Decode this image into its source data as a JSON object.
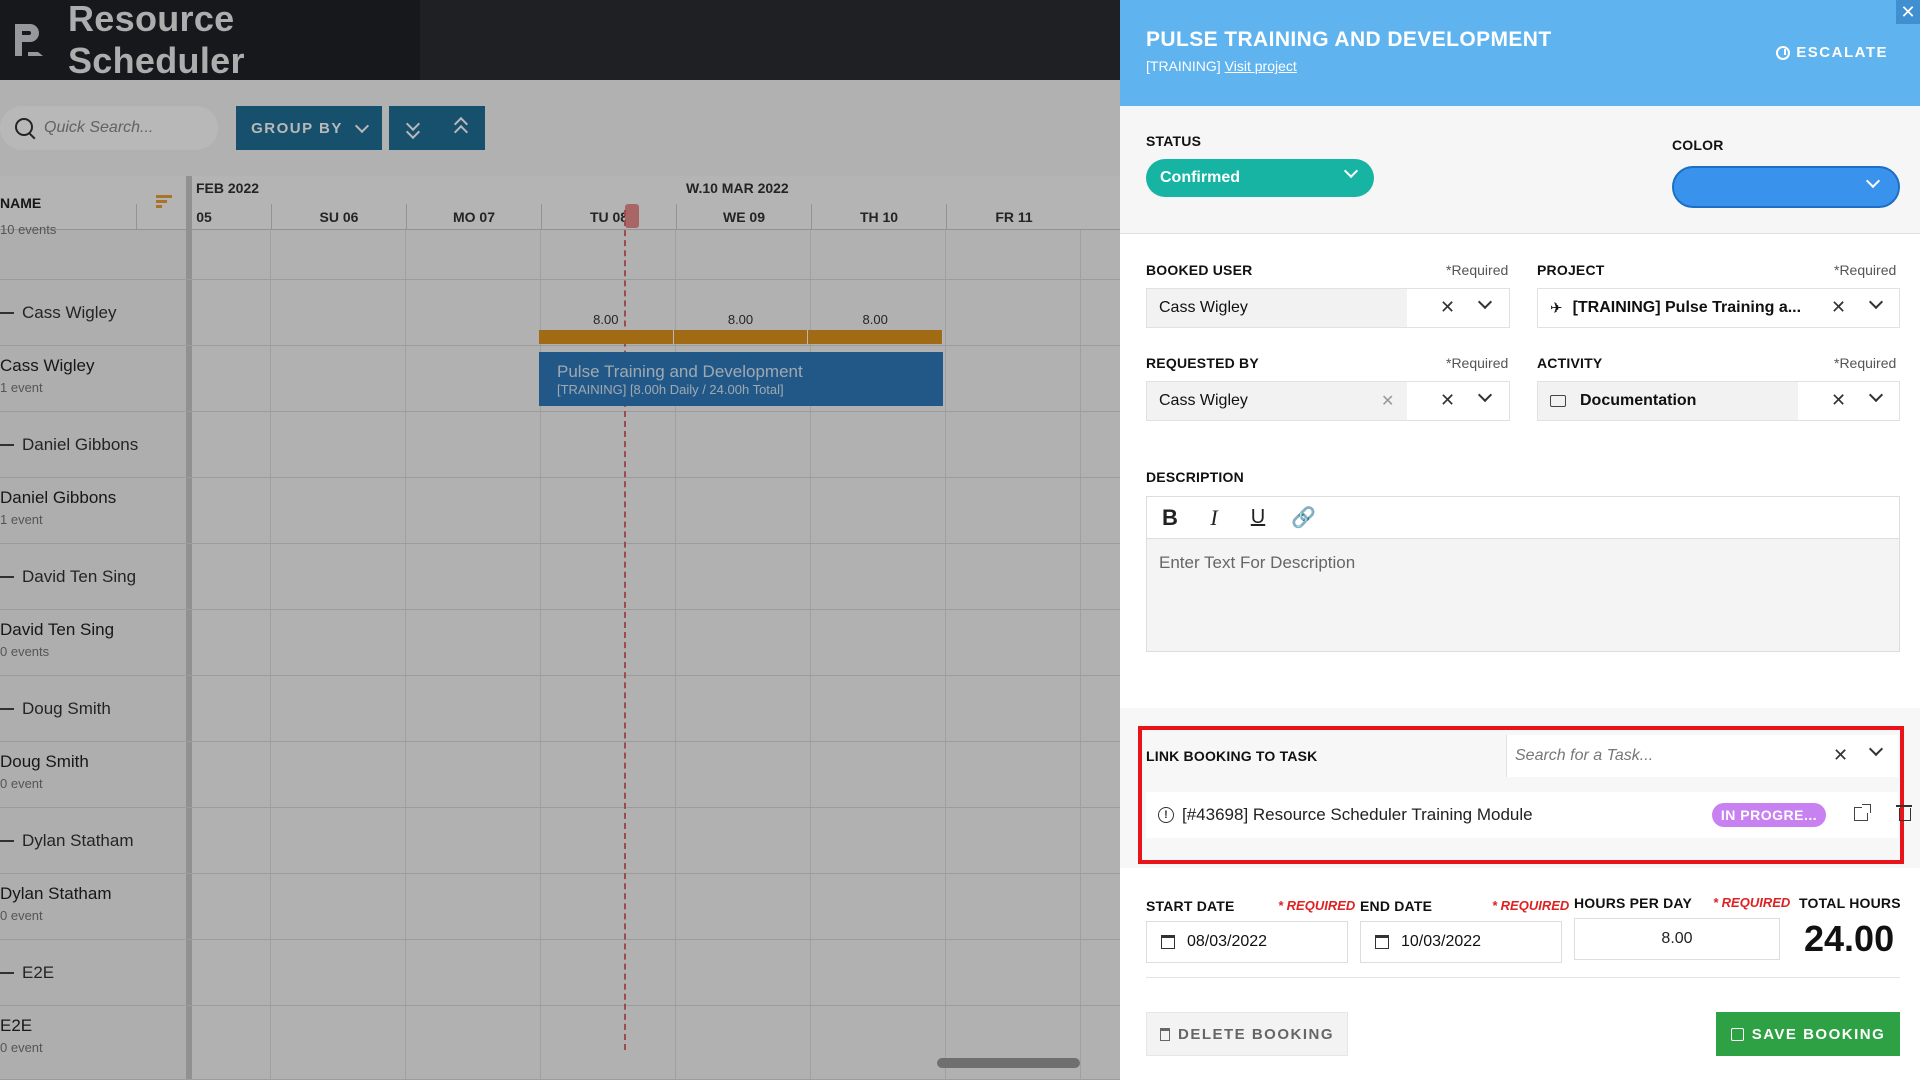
{
  "app": {
    "title": "Resource Scheduler",
    "brand_color": "#1f2227"
  },
  "toolbar": {
    "search_placeholder": "Quick Search...",
    "group_by_label": "GROUP BY"
  },
  "grid": {
    "name_header": "NAME",
    "month_prev": "FEB 2022",
    "month_current": "W.10 MAR 2022",
    "days": [
      "05",
      "SU 06",
      "MO 07",
      "TU 08",
      "WE 09",
      "TH 10",
      "FR 11"
    ],
    "top_row_sub": "10 events",
    "rows": [
      {
        "type": "group",
        "label": "Cass Wigley"
      },
      {
        "type": "user",
        "label": "Cass Wigley",
        "sub": "1 event"
      },
      {
        "type": "group",
        "label": "Daniel Gibbons"
      },
      {
        "type": "user",
        "label": "Daniel Gibbons",
        "sub": "1 event"
      },
      {
        "type": "group",
        "label": "David Ten Sing"
      },
      {
        "type": "user",
        "label": "David Ten Sing",
        "sub": "0 events"
      },
      {
        "type": "group",
        "label": "Doug Smith"
      },
      {
        "type": "user",
        "label": "Doug Smith",
        "sub": "0 event"
      },
      {
        "type": "group",
        "label": "Dylan Statham"
      },
      {
        "type": "user",
        "label": "Dylan Statham",
        "sub": "0 event"
      },
      {
        "type": "group",
        "label": "E2E"
      },
      {
        "type": "user",
        "label": "E2E",
        "sub": "0 event"
      }
    ],
    "hours": [
      "8.00",
      "8.00",
      "8.00"
    ],
    "booking": {
      "title": "Pulse Training and Development",
      "sub": "[TRAINING] [8.00h Daily / 24.00h Total]"
    }
  },
  "panel": {
    "title": "PULSE TRAINING AND DEVELOPMENT",
    "project_tag": "[TRAINING]",
    "visit_link": "Visit project",
    "escalate_label": "ESCALATE",
    "close": "✕",
    "status_label": "STATUS",
    "status_value": "Confirmed",
    "status_color": "#17b4a4",
    "color_label": "COLOR",
    "color_value": "#3993ec",
    "required": "*Required",
    "booked_user_label": "BOOKED USER",
    "booked_user_value": "Cass Wigley",
    "project_label": "PROJECT",
    "project_value": "[TRAINING] Pulse Training a...",
    "requested_by_label": "REQUESTED BY",
    "requested_by_value": "Cass Wigley",
    "activity_label": "ACTIVITY",
    "activity_value": "Documentation",
    "description_label": "DESCRIPTION",
    "description_placeholder": "Enter Text For Description",
    "link_task_label": "LINK BOOKING TO TASK",
    "task_search_placeholder": "Search for a Task...",
    "linked_task": "[#43698] Resource Scheduler Training Module",
    "linked_task_status": "IN PROGRE...",
    "start_date_label": "START DATE",
    "end_date_label": "END DATE",
    "hours_per_day_label": "HOURS PER DAY",
    "total_hours_label": "TOTAL HOURS",
    "required_caps": "* REQUIRED",
    "start_date": "08/03/2022",
    "end_date": "10/03/2022",
    "hours_per_day": "8.00",
    "total_hours": "24.00",
    "delete_label": "DELETE BOOKING",
    "save_label": "SAVE BOOKING",
    "save_color": "#2ea144"
  }
}
